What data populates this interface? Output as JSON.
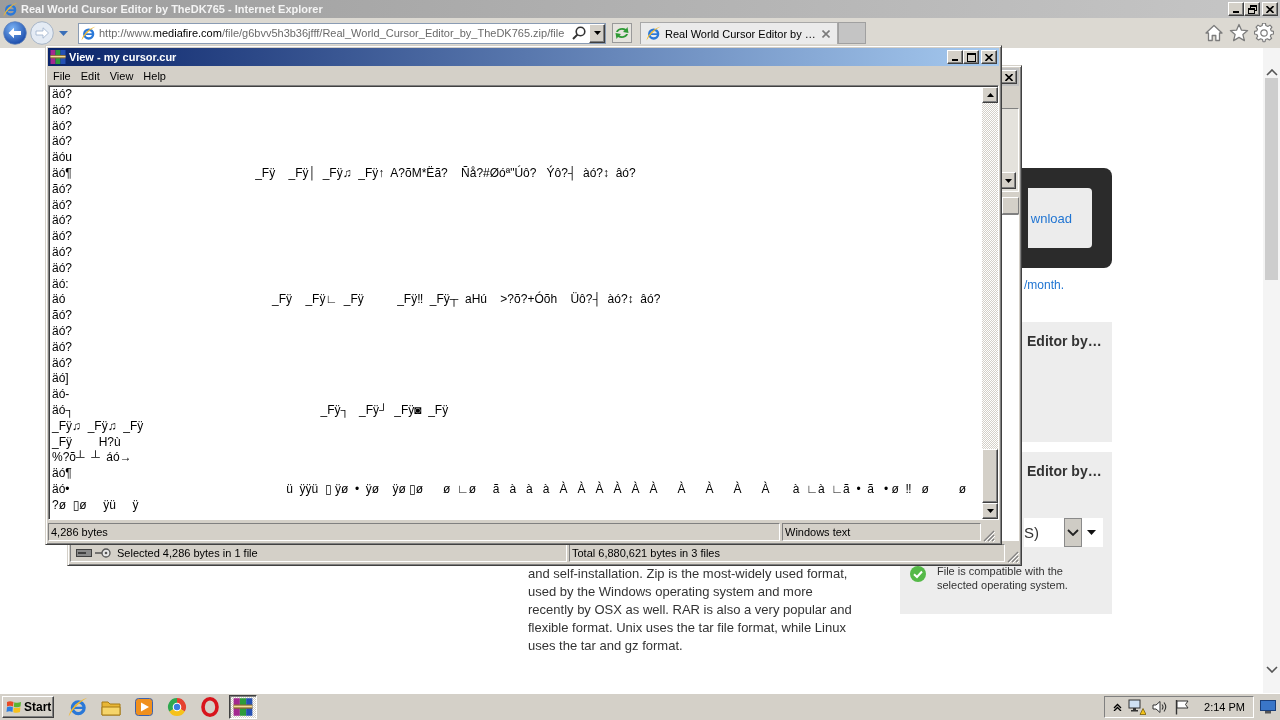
{
  "ie_window": {
    "title": "Real World Cursor Editor by TheDK765 - Internet Explorer",
    "address": {
      "prefix": "http://www.",
      "domain": "mediafire.com",
      "path": "/file/g6bvv5h3b36jfff/Real_World_Cursor_Editor_by_TheDK765.zip/file"
    },
    "tab": "Real World Cursor Editor by …"
  },
  "web_page": {
    "download_button": "wnload",
    "price_link": "/month.",
    "panels": [
      {
        "heading": "Editor by…"
      },
      {
        "heading": "Editor by…",
        "os_select": "S)",
        "compat_note": "File is compatible with the selected operating system."
      }
    ],
    "paragraph": "and self-installation. Zip is the most-widely used format, used by the Windows operating system and more recently by OSX as well. RAR is also a very popular and flexible format. Unix uses the tar file format, while Linux uses the tar and gz format."
  },
  "archive_window": {
    "status": [
      "Selected 4,286 bytes in 1 file",
      "Total 6,880,621 bytes in 3 files"
    ]
  },
  "viewer_window": {
    "title": "View - my cursor.cur",
    "menu": [
      "File",
      "Edit",
      "View",
      "Help"
    ],
    "lines": [
      "äó?",
      "äó?",
      "äó?",
      "äó?",
      "äóu",
      "äó¶                                                       _Fÿ    _Fÿ│  _Fÿ♫  _Fÿ↑  A?õM*Ëã?    Ñå?#Øóª\"Úô?   Ýô?┤  àó?↕  âó?",
      "ãó?",
      "äó?",
      "äó?",
      "äó?",
      "äó?",
      "äó?",
      "äó:",
      "äó                                                              _Fÿ    _Fÿ∟  _Fÿ          _Fÿ‼  _Fÿ┬  aHú    >?õ?+Óõh    Üô?┤  àó?↕  âó?",
      "ãó?",
      "äó?",
      "äó?",
      "äó?",
      "äó]",
      "äó-",
      "äó┐                                                                          _Fÿ┐   _Fÿ┘  _Fÿ◙  _Fÿ",
      "_Fÿ♫  _Fÿ♫  _Fÿ",
      "_Fÿ        H?ù",
      "%?õ┴  ┴  áó→",
      "äó¶",
      "äó•                                                                 ü  ÿÿü  ▯ ÿø  •  ÿø    ÿø ▯ø      ø  ∟ø     ã   à   à   à   À   À   À   À   À   À      À      À      À      À       à  ∟à  ∟ã  •  ã   • ø  ‼   ø         ø",
      "?ø  ▯ø     ÿü     ÿ"
    ],
    "status": [
      "4,286 bytes",
      "Windows text"
    ]
  },
  "taskbar": {
    "start": "Start",
    "apps": [
      {
        "kind": "ring_logo",
        "selected": false
      },
      {
        "kind": "folder",
        "selected": false
      },
      {
        "kind": "play_tile",
        "selected": false
      },
      {
        "kind": "segment_circle",
        "selected": false
      },
      {
        "kind": "red_ring",
        "selected": false
      },
      {
        "kind": "books",
        "selected": true
      }
    ],
    "clock": "2:14 PM"
  }
}
